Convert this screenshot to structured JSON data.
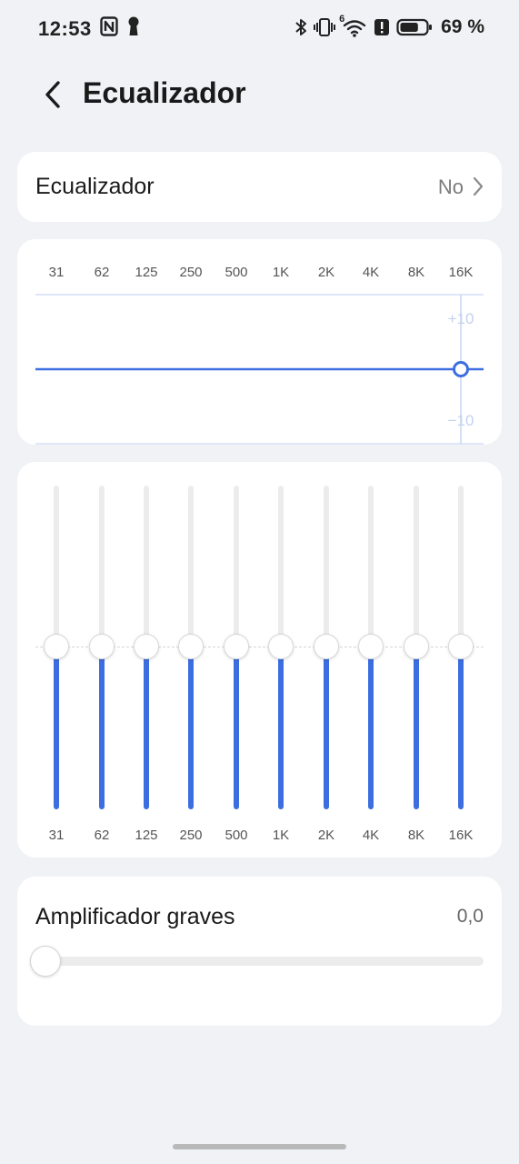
{
  "status_bar": {
    "time": "12:53",
    "left_icons": [
      "nfc-icon",
      "keyhole-icon"
    ],
    "right_icons": [
      "bluetooth-icon",
      "vibrate-icon",
      "wifi-icon",
      "alert-icon",
      "battery-icon"
    ],
    "wifi_badge": "6",
    "battery_text": "69 %",
    "battery_level": 0.69
  },
  "header": {
    "back_icon": "chevron-left-icon",
    "title": "Ecualizador"
  },
  "eq_toggle": {
    "label": "Ecualizador",
    "value": "No",
    "chevron_icon": "chevron-right-icon"
  },
  "curve": {
    "frequencies": [
      "31",
      "62",
      "125",
      "250",
      "500",
      "1K",
      "2K",
      "4K",
      "8K",
      "16K"
    ],
    "scale_top": "+10",
    "scale_mid": "0",
    "scale_bottom": "−10",
    "range": [
      -10,
      10
    ],
    "gains": [
      0,
      0,
      0,
      0,
      0,
      0,
      0,
      0,
      0,
      0
    ],
    "selected_band": "16K"
  },
  "sliders": {
    "bands": [
      {
        "freq": "31",
        "gain": 0
      },
      {
        "freq": "62",
        "gain": 0
      },
      {
        "freq": "125",
        "gain": 0
      },
      {
        "freq": "250",
        "gain": 0
      },
      {
        "freq": "500",
        "gain": 0
      },
      {
        "freq": "1K",
        "gain": 0
      },
      {
        "freq": "2K",
        "gain": 0
      },
      {
        "freq": "4K",
        "gain": 0
      },
      {
        "freq": "8K",
        "gain": 0
      },
      {
        "freq": "16K",
        "gain": 0
      }
    ]
  },
  "bass": {
    "label": "Amplificador graves",
    "value": "0,0",
    "level": 0
  },
  "colors": {
    "accent": "#3d6ee0",
    "background": "#f1f2f6",
    "card": "#ffffff"
  }
}
